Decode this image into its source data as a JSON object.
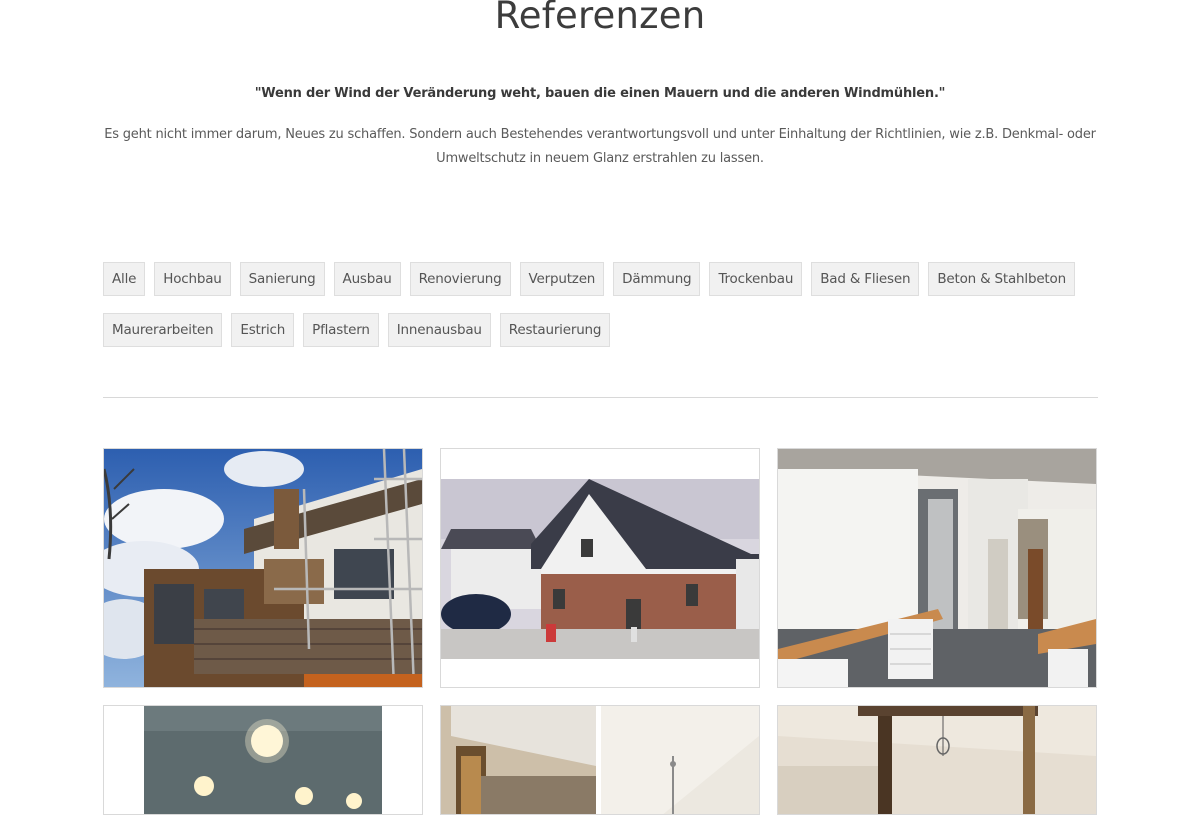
{
  "page": {
    "title": "Referenzen",
    "quote": "\"Wenn der Wind der Veränderung weht, bauen die einen Mauern und die anderen Windmühlen.\"",
    "intro": "Es geht nicht immer darum, Neues zu schaffen. Sondern auch Bestehendes verantwortungsvoll und unter Einhaltung der Richtlinien, wie z.B. Denkmal- oder Umweltschutz in neuem Glanz erstrahlen zu lassen."
  },
  "filters": {
    "row1": [
      {
        "label": "Alle"
      },
      {
        "label": "Hochbau"
      },
      {
        "label": "Sanierung"
      },
      {
        "label": "Ausbau"
      },
      {
        "label": "Renovierung"
      },
      {
        "label": "Verputzen"
      },
      {
        "label": "Dämmung"
      },
      {
        "label": "Trockenbau"
      },
      {
        "label": "Bad & Fliesen"
      },
      {
        "label": "Beton & Stahlbeton"
      }
    ],
    "row2": [
      {
        "label": "Maurerarbeiten"
      },
      {
        "label": "Estrich"
      },
      {
        "label": "Pflastern"
      },
      {
        "label": "Innenausbau"
      },
      {
        "label": "Restaurierung"
      }
    ]
  },
  "gallery": [
    {
      "name": "reference-photo-scaffolding-house"
    },
    {
      "name": "reference-photo-new-brick-house"
    },
    {
      "name": "reference-photo-interior-worktop"
    },
    {
      "name": "reference-photo-ceiling-lights"
    },
    {
      "name": "reference-photo-attic-bathroom"
    },
    {
      "name": "reference-photo-timber-beam-attic"
    }
  ]
}
